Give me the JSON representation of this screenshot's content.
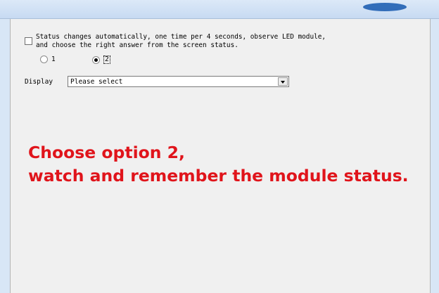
{
  "form": {
    "instruction": "Status changes automatically, one time per 4 seconds, observe LED module, and choose the right answer from the screen status.",
    "radio_options": [
      {
        "label": "1",
        "selected": false
      },
      {
        "label": "2",
        "selected": true
      }
    ],
    "display_label": "Display",
    "display_select_value": "Please select"
  },
  "overlay": {
    "line1": "Choose option 2,",
    "line2": "watch and remember the module status.",
    "color": "#e0141b"
  }
}
